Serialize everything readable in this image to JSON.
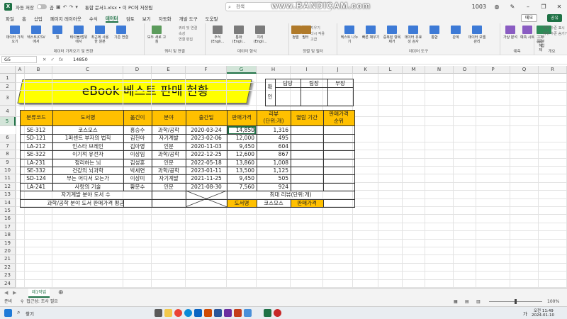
{
  "window": {
    "autosave_label": "자동 저장",
    "autosave_state": "끔",
    "file_title": "통합 문서1.xlsx • 이 PC에 저장됨",
    "search_placeholder": "검색",
    "watermark": "www.BANDICAM.com",
    "user_count": "1003",
    "memo_label": "메모",
    "share_label": "공유"
  },
  "ribbon_tabs": [
    "파일",
    "홈",
    "삽입",
    "페이지 레이아웃",
    "수식",
    "데이터",
    "검토",
    "보기",
    "자동화",
    "개발 도구",
    "도움말"
  ],
  "active_tab": "데이터",
  "ribbon": {
    "groups": [
      {
        "label": "데이터 가져오기 및 변환",
        "items": [
          "데이터 가져오기",
          "텍스트/CSV에서",
          "웹",
          "테이블/범위에서",
          "최근에 사용한 원본",
          "기존 연결"
        ]
      },
      {
        "label": "쿼리 및 연결",
        "items": [
          "모두 새로 고침"
        ],
        "small": [
          "쿼리 및 연결",
          "속성",
          "연결 편집"
        ]
      },
      {
        "label": "데이터 형식",
        "items": [
          "주식 (Engli...",
          "통화 (Engli...",
          "지리 (Engli..."
        ]
      },
      {
        "label": "정렬 및 필터",
        "items": [
          "정렬",
          "필터"
        ],
        "small": [
          "지우기",
          "다시 적용",
          "고급"
        ]
      },
      {
        "label": "데이터 도구",
        "items": [
          "텍스트 나누기",
          "빠른 채우기",
          "중복된 항목 제거",
          "데이터 유효성 검사",
          "통합",
          "관계",
          "데이터 모델 관리"
        ]
      },
      {
        "label": "예측",
        "items": [
          "가상 분석",
          "예측 시트"
        ]
      },
      {
        "label": "개요",
        "items": [
          "그룹",
          "그룹 해제",
          "부분합"
        ],
        "small": [
          "하위 수준 표시",
          "하위 수준 숨기기"
        ]
      }
    ]
  },
  "formula_bar": {
    "name_box": "G5",
    "fx": "fx",
    "value": "14850"
  },
  "columns": [
    "A",
    "B",
    "C",
    "D",
    "E",
    "F",
    "G",
    "H",
    "I",
    "J",
    "K",
    "L",
    "M",
    "N",
    "O",
    "P",
    "Q",
    "R"
  ],
  "selected_column": "G",
  "rows": [
    "1",
    "2",
    "3",
    "4",
    "5",
    "6",
    "7",
    "8",
    "9",
    "10",
    "11",
    "12",
    "13",
    "14",
    "15",
    "16",
    "17",
    "18",
    "19",
    "20",
    "21",
    "22",
    "23",
    "24",
    "25"
  ],
  "selected_row": "5",
  "sheet": {
    "title": "eBook 베스트 판매 현황",
    "approval": {
      "side_label": "확\n인",
      "side_top": "확",
      "side_bottom": "인",
      "headers": [
        "담당",
        "팀장",
        "부장"
      ]
    },
    "headers": [
      "분류코드",
      "도서명",
      "옮긴이",
      "분야",
      "출간일",
      "판매가격",
      "리뷰\n(단위:개)",
      "열람 기간",
      "판매가격\n순위"
    ],
    "header_review_top": "리뷰",
    "header_review_bottom": "(단위:개)",
    "header_rank_top": "판매가격",
    "header_rank_bottom": "순위",
    "data": [
      [
        "SE-312",
        "코스모스",
        "홍승수",
        "과학/공학",
        "2020-03-24",
        "14,850",
        "1,316"
      ],
      [
        "SD-121",
        "1퍼센트 부자의 법칙",
        "김천아",
        "자기계발",
        "2023-02-06",
        "12,000",
        "495"
      ],
      [
        "LA-212",
        "인스타 브레인",
        "김아영",
        "인문",
        "2020-11-03",
        "9,450",
        "604"
      ],
      [
        "SE-322",
        "이기적 유전자",
        "이상임",
        "과학/공학",
        "2022-12-25",
        "12,600",
        "867"
      ],
      [
        "LA-231",
        "정리하는 뇌",
        "김성훈",
        "인문",
        "2022-05-18",
        "13,860",
        "1,008"
      ],
      [
        "SE-332",
        "건강의 뇌과학",
        "박세연",
        "과학/공학",
        "2023-01-11",
        "13,500",
        "1,125"
      ],
      [
        "SD-124",
        "부는 어디서 오는가",
        "이상미",
        "자기계발",
        "2021-11-25",
        "9,450",
        "505"
      ],
      [
        "LA-241",
        "사랑의 기술",
        "황문수",
        "인문",
        "2021-08-30",
        "7,560",
        "924"
      ]
    ],
    "summary": {
      "row13_label": "자기계발 분야 도서 수",
      "row14_label": "과학/공학 분야 도서 판매가격 평균",
      "max_review_label": "최대 리뷰(단위:개)",
      "book_name_label": "도서명",
      "book_name_value": "코스모스",
      "price_label": "판매가격"
    }
  },
  "sheet_tab": "제1작업",
  "status": {
    "ready": "준비",
    "accessibility": "접근성: 조사 필요",
    "zoom": "100%"
  },
  "taskbar": {
    "search": "찾기",
    "time": "오전 11:49",
    "date": "2024-01-10",
    "lang": "가"
  },
  "colors": {
    "accent": "#1e7145",
    "header_fill": "#ffc000",
    "banner": "#ffff00"
  }
}
